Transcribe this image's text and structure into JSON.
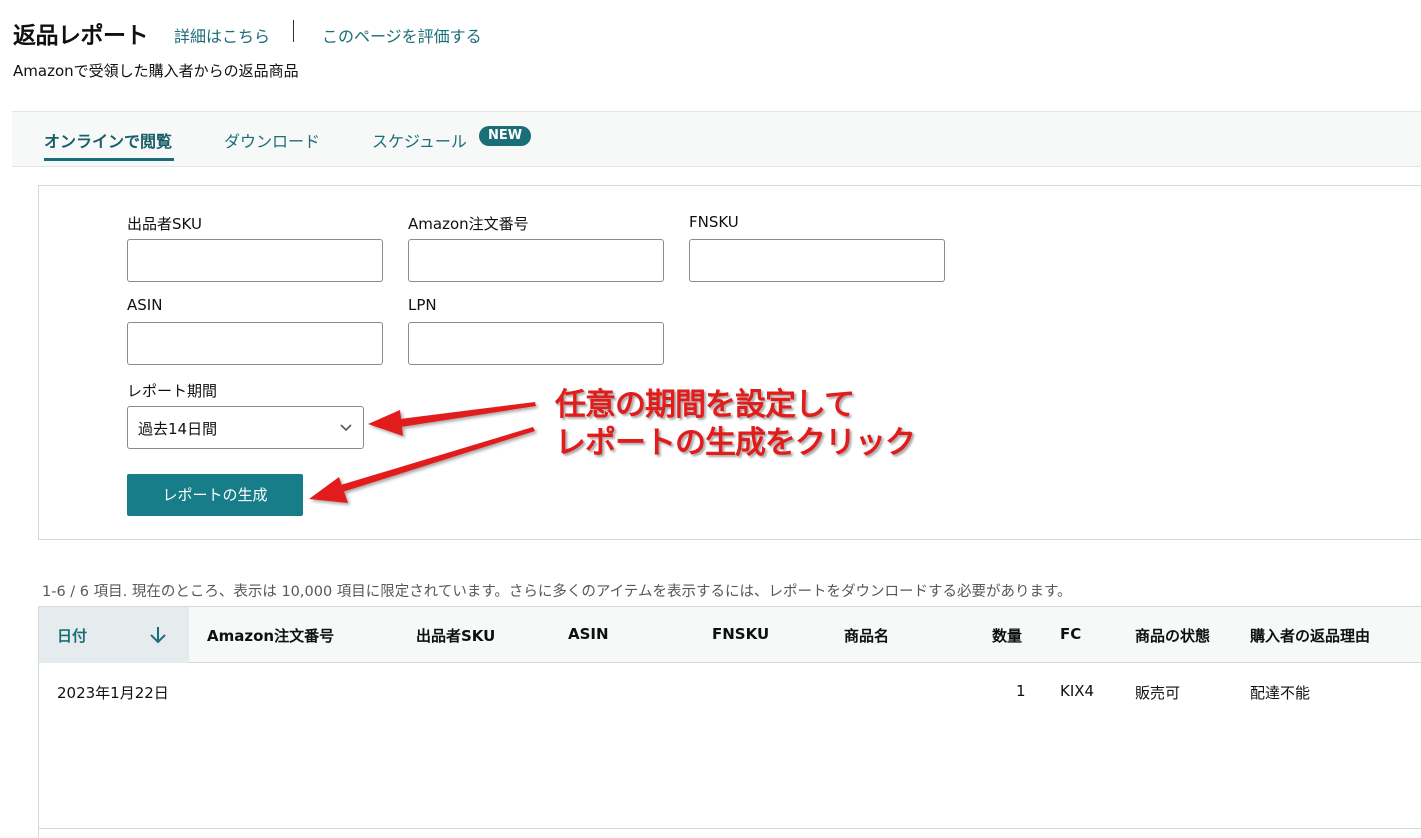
{
  "header": {
    "title": "返品レポート",
    "learn_more": "詳細はこちら",
    "rate_page": "このページを評価する",
    "subtitle": "Amazonで受領した購入者からの返品商品"
  },
  "tabs": [
    {
      "label": "オンラインで閲覧",
      "active": true
    },
    {
      "label": "ダウンロード",
      "active": false
    },
    {
      "label": "スケジュール",
      "active": false,
      "badge": "NEW"
    }
  ],
  "filters": {
    "seller_sku_label": "出品者SKU",
    "order_id_label": "Amazon注文番号",
    "fnsku_label": "FNSKU",
    "asin_label": "ASIN",
    "lpn_label": "LPN",
    "period_label": "レポート期間",
    "period_value": "過去14日間",
    "generate_button": "レポートの生成"
  },
  "annotation": {
    "line1": "任意の期間を設定して",
    "line2": "レポートの生成をクリック",
    "color": "#e21b1b"
  },
  "results": {
    "info": "1-6 / 6 項目. 現在のところ、表示は 10,000 項目に限定されています。さらに多くのアイテムを表示するには、レポートをダウンロードする必要があります。",
    "columns": [
      "日付",
      "Amazon注文番号",
      "出品者SKU",
      "ASIN",
      "FNSKU",
      "商品名",
      "数量",
      "FC",
      "商品の状態",
      "購入者の返品理由"
    ],
    "rows": [
      {
        "date": "2023年1月22日",
        "order_id": "",
        "sku": "",
        "asin": "",
        "fnsku": "",
        "product_name": "",
        "quantity": "1",
        "fc": "KIX4",
        "condition": "販売可",
        "reason": "配達不能"
      }
    ]
  },
  "colors": {
    "accent": "#1a6e77",
    "button": "#177e89"
  }
}
